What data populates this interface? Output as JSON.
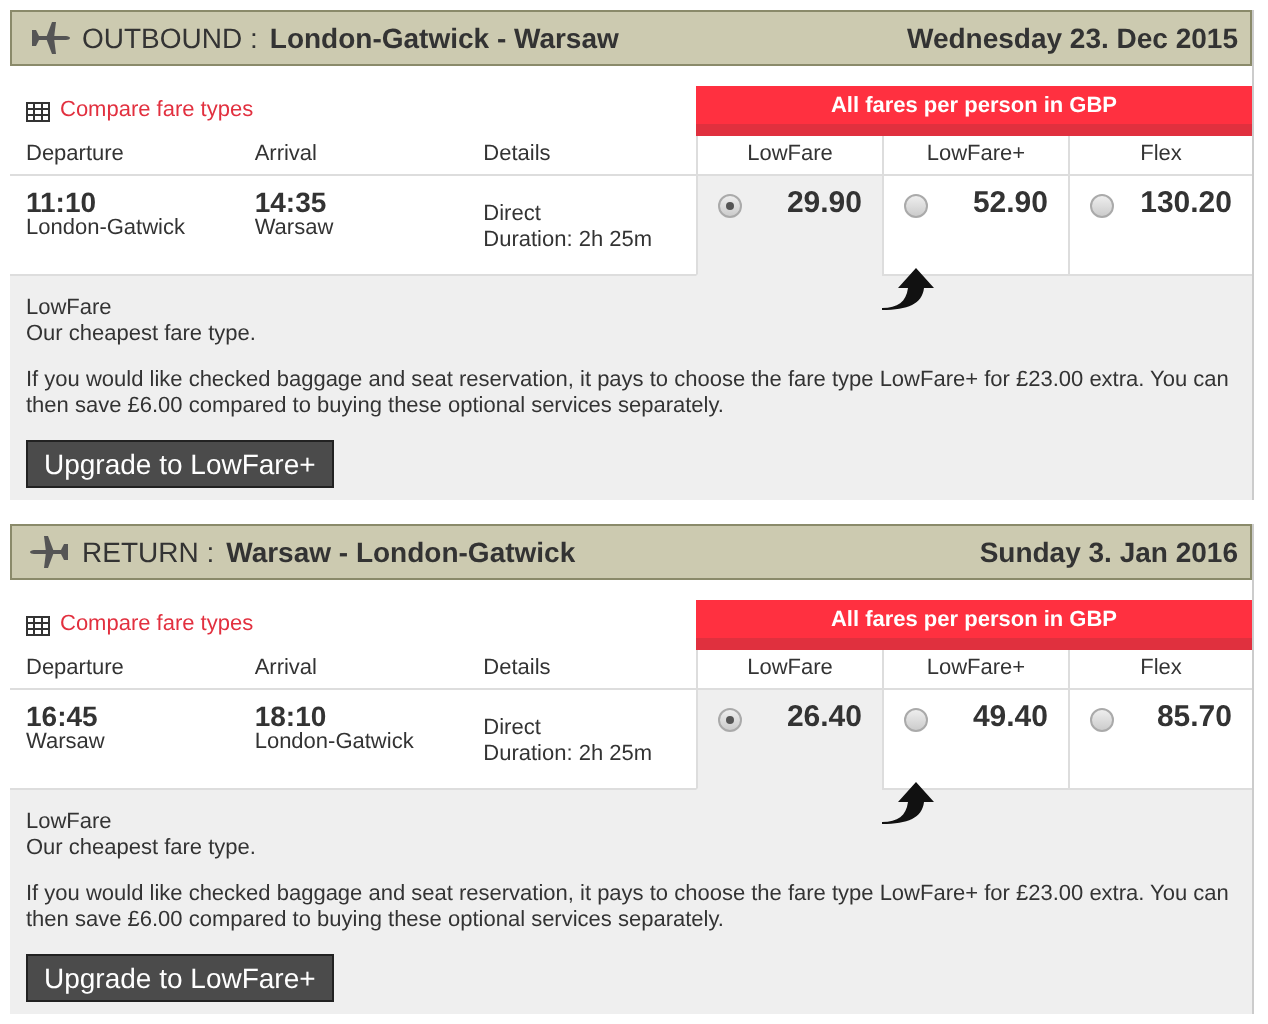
{
  "trips": [
    {
      "kind": "outbound",
      "direction": "OUTBOUND :",
      "route": "London-Gatwick - Warsaw",
      "date": "Wednesday 23. Dec 2015",
      "compare_link": "Compare fare types",
      "fare_banner": "All fares per person in GBP",
      "columns": [
        "Departure",
        "Arrival",
        "Details"
      ],
      "departure": {
        "time": "11:10",
        "place": "London-Gatwick"
      },
      "arrival": {
        "time": "14:35",
        "place": "Warsaw"
      },
      "details": {
        "stops": "Direct",
        "duration": "Duration: 2h 25m"
      },
      "fares": [
        {
          "name": "LowFare",
          "price": "29.90",
          "selected": true,
          "recommended": false
        },
        {
          "name": "LowFare+",
          "price": "52.90",
          "selected": false,
          "recommended": true
        },
        {
          "name": "Flex",
          "price": "130.20",
          "selected": false,
          "recommended": false
        }
      ],
      "info": {
        "fare_name": "LowFare",
        "description": "Our cheapest fare type.",
        "text": "If you would like checked baggage and seat reservation, it pays to choose the fare type LowFare+ for £23.00 extra. You can then save £6.00 compared to buying these optional services separately.",
        "button": "Upgrade to LowFare+"
      }
    },
    {
      "kind": "return",
      "direction": "RETURN :",
      "route": "Warsaw - London-Gatwick",
      "date": "Sunday 3. Jan 2016",
      "compare_link": "Compare fare types",
      "fare_banner": "All fares per person in GBP",
      "columns": [
        "Departure",
        "Arrival",
        "Details"
      ],
      "departure": {
        "time": "16:45",
        "place": "Warsaw"
      },
      "arrival": {
        "time": "18:10",
        "place": "London-Gatwick"
      },
      "details": {
        "stops": "Direct",
        "duration": "Duration: 2h 25m"
      },
      "fares": [
        {
          "name": "LowFare",
          "price": "26.40",
          "selected": true,
          "recommended": false
        },
        {
          "name": "LowFare+",
          "price": "49.40",
          "selected": false,
          "recommended": true
        },
        {
          "name": "Flex",
          "price": "85.70",
          "selected": false,
          "recommended": false
        }
      ],
      "info": {
        "fare_name": "LowFare",
        "description": "Our cheapest fare type.",
        "text": "If you would like checked baggage and seat reservation, it pays to choose the fare type LowFare+ for £23.00 extra. You can then save £6.00 compared to buying these optional services separately.",
        "button": "Upgrade to LowFare+"
      }
    }
  ]
}
